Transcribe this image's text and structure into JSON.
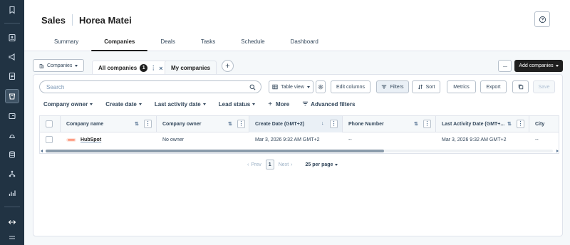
{
  "nav_rail": {
    "items": [
      {
        "icon": "bookmark-icon"
      },
      {
        "icon": "contacts-icon"
      },
      {
        "icon": "megaphone-icon"
      },
      {
        "icon": "document-icon"
      },
      {
        "icon": "crm-table-icon"
      },
      {
        "icon": "commerce-icon"
      },
      {
        "icon": "service-icon"
      },
      {
        "icon": "database-icon"
      },
      {
        "icon": "automation-icon"
      },
      {
        "icon": "reports-icon"
      },
      {
        "icon": "collapse-arrows-icon"
      },
      {
        "icon": "bottom-menu-icon"
      }
    ],
    "active_icon": "crm-table-icon"
  },
  "header": {
    "section": "Sales",
    "user": "Horea Matei"
  },
  "tabs": [
    {
      "label": "Summary"
    },
    {
      "label": "Companies"
    },
    {
      "label": "Deals"
    },
    {
      "label": "Tasks"
    },
    {
      "label": "Schedule"
    },
    {
      "label": "Dashboard"
    }
  ],
  "active_tab": "Companies",
  "view_bar": {
    "object_select": "Companies",
    "views": [
      {
        "label": "All companies",
        "count": "1"
      },
      {
        "label": "My companies"
      }
    ],
    "add_view": "+",
    "more": "···",
    "add_button": "Add companies"
  },
  "toolbar": {
    "search_placeholder": "Search",
    "table_view": "Table view",
    "edit_columns": "Edit columns",
    "filters": "Filters",
    "sort": "Sort",
    "metrics": "Metrics",
    "export": "Export",
    "save": "Save"
  },
  "filter_bar": {
    "company_owner": "Company owner",
    "create_date": "Create date",
    "last_activity_date": "Last activity date",
    "lead_status": "Lead status",
    "more": "More",
    "advanced": "Advanced filters"
  },
  "table": {
    "columns": [
      "Company name",
      "Company owner",
      "Create Date (GMT+2)",
      "Phone Number",
      "Last Activity Date (GMT+...",
      "City"
    ],
    "sorted_column": "Create Date (GMT+2)",
    "rows": [
      {
        "company_name": "HubSpot",
        "company_owner": "No owner",
        "create_date": "Mar 3, 2026 9:32 AM GMT+2",
        "phone": "--",
        "last_activity": "Mar 3, 2026 9:32 AM GMT+2",
        "city": "--"
      }
    ]
  },
  "pagination": {
    "prev": "Prev",
    "page": "1",
    "next": "Next",
    "per_page": "25 per page"
  },
  "colors": {
    "rail": "#213343",
    "primary_button": "#1f1f1f",
    "link": "#1f1f1f",
    "hubspot_logo": "#ff7a59"
  }
}
